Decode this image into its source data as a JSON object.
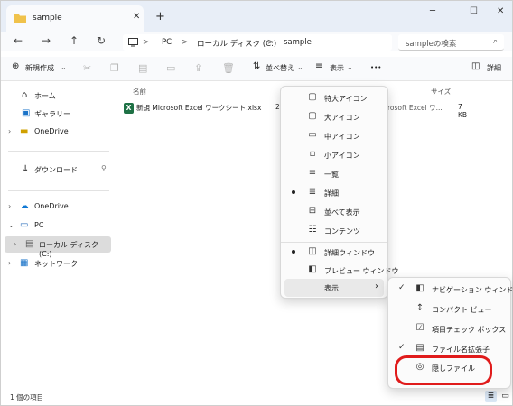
{
  "window": {
    "tab_title": "sample",
    "tab_close": "✕",
    "new_tab": "+",
    "min": "─",
    "max": "☐",
    "close": "✕"
  },
  "nav": {
    "back": "←",
    "forward": "→",
    "up": "↑",
    "refresh": "↻",
    "breadcrumb": [
      "PC",
      "ローカル ディスク (C:)",
      "sample"
    ],
    "crumb_sep": ">",
    "search_placeholder": "sampleの検索"
  },
  "toolbar": {
    "new": "新規作成",
    "sort": "並べ替え",
    "view": "表示",
    "more": "•••",
    "details": "詳細"
  },
  "sidebar": {
    "items": [
      {
        "label": "ホーム"
      },
      {
        "label": "ギャラリー"
      },
      {
        "label": "OneDrive"
      },
      {
        "label": "ダウンロード"
      },
      {
        "label": "OneDrive"
      },
      {
        "label": "PC"
      },
      {
        "label": "ローカル ディスク (C:)"
      },
      {
        "label": "ネットワーク"
      }
    ]
  },
  "files": {
    "columns": {
      "name": "名前",
      "size": "サイズ"
    },
    "rows": [
      {
        "name": "新規 Microsoft Excel ワークシート.xlsx",
        "date_partial": "2",
        "type_partial": "rosoft Excel ワ...",
        "size": "7 KB"
      }
    ]
  },
  "status": {
    "count": "1 個の項目"
  },
  "view_menu": {
    "items": [
      {
        "label": "特大アイコン",
        "icon": "▢"
      },
      {
        "label": "大アイコン",
        "icon": "▢"
      },
      {
        "label": "中アイコン",
        "icon": "▭"
      },
      {
        "label": "小アイコン",
        "icon": "▫"
      },
      {
        "label": "一覧",
        "icon": "≡"
      },
      {
        "label": "詳細",
        "icon": "≣"
      },
      {
        "label": "並べて表示",
        "icon": "⊟"
      },
      {
        "label": "コンテンツ",
        "icon": "☷"
      },
      {
        "label": "詳細ウィンドウ",
        "icon": "◫"
      },
      {
        "label": "プレビュー ウィンドウ",
        "icon": "◧"
      },
      {
        "label": "表示",
        "icon": ""
      }
    ],
    "submenu_arrow": "›"
  },
  "show_submenu": {
    "items": [
      {
        "label": "ナビゲーション ウィンドウ",
        "icon": "◧"
      },
      {
        "label": "コンパクト ビュー",
        "icon": "↕"
      },
      {
        "label": "項目チェック ボックス",
        "icon": "☑"
      },
      {
        "label": "ファイル名拡張子",
        "icon": "▤"
      },
      {
        "label": "隠しファイル",
        "icon": "◎"
      }
    ]
  },
  "colors": {
    "accent": "#0067c0",
    "highlight_circle": "#e01b1b",
    "folder": "#f0c24b"
  }
}
